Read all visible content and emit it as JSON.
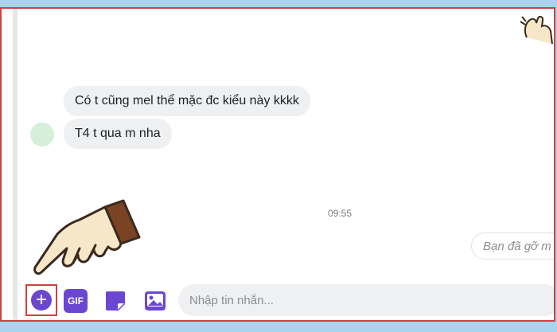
{
  "chat": {
    "messages": [
      {
        "text": "Có t cũng mel thể mặc đc kiểu này kkkk"
      },
      {
        "text": "T4 t qua m nha"
      }
    ],
    "avatar_initials": "",
    "timestamp": "09:55",
    "recalled_message": "Bạn đã gỡ m"
  },
  "composer": {
    "placeholder": "Nhập tin nhắn...",
    "gif_label": "GIF"
  },
  "colors": {
    "accent": "#6b47d1",
    "highlight": "#d0413e",
    "bubble": "#eff0f2"
  },
  "icons": [
    "plus-icon",
    "gif-icon",
    "sticker-icon",
    "image-icon",
    "pointing-hand-icon"
  ]
}
